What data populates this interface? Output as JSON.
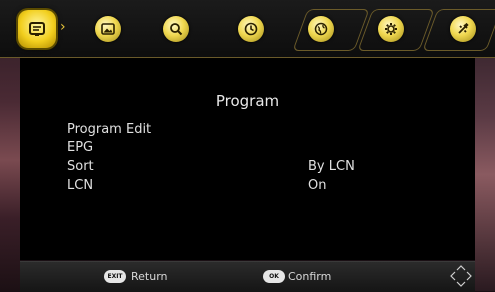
{
  "menu": {
    "tabs": [
      {
        "name": "program",
        "icon": "program-icon",
        "active": true
      },
      {
        "name": "picture",
        "icon": "picture-icon"
      },
      {
        "name": "search",
        "icon": "search-icon"
      },
      {
        "name": "time",
        "icon": "clock-icon"
      },
      {
        "name": "option",
        "icon": "globe-icon"
      },
      {
        "name": "system",
        "icon": "gear-icon"
      },
      {
        "name": "usb",
        "icon": "usb-icon"
      }
    ],
    "accent_color": "#f0d030"
  },
  "panel": {
    "title": "Program",
    "items": [
      {
        "label": "Program Edit",
        "value": ""
      },
      {
        "label": "EPG",
        "value": ""
      },
      {
        "label": "Sort",
        "value": "By LCN"
      },
      {
        "label": "LCN",
        "value": "On"
      }
    ]
  },
  "footer": {
    "return_key": "EXIT",
    "return_label": "Return",
    "confirm_key": "OK",
    "confirm_label": "Confirm"
  }
}
